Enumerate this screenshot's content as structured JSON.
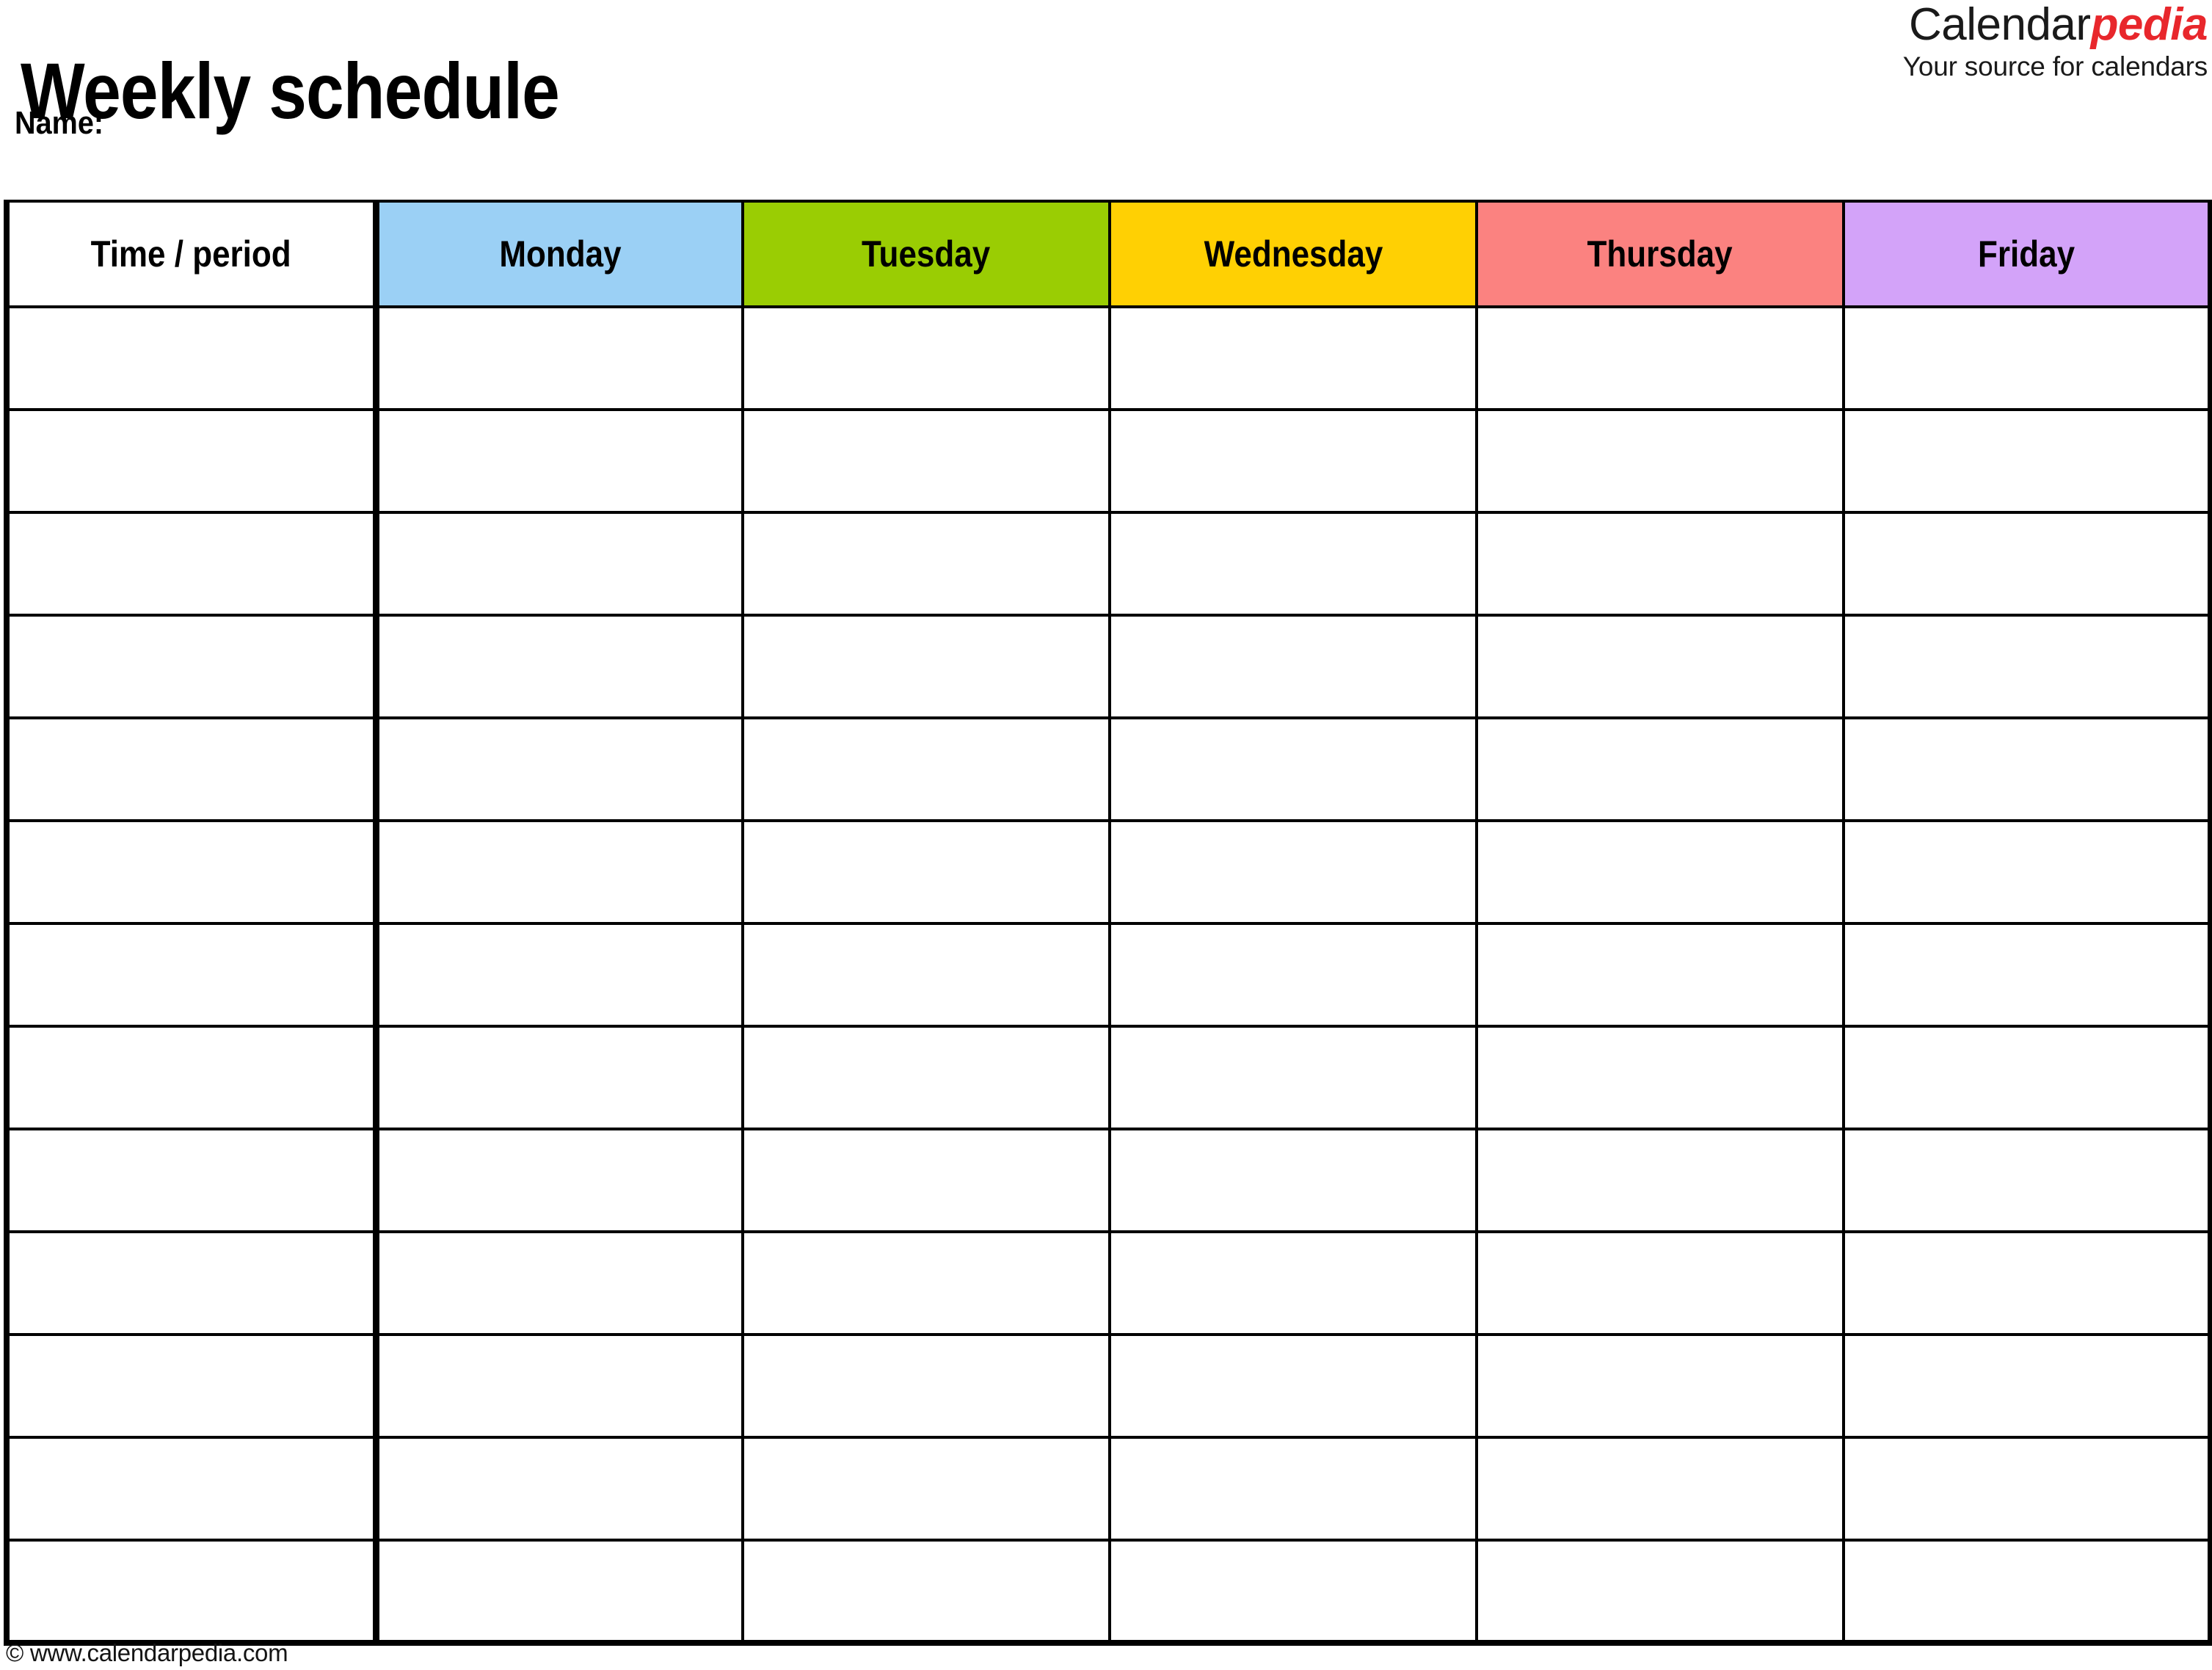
{
  "document": {
    "title": "Weekly schedule",
    "name_label": "Name:"
  },
  "brand": {
    "word_primary": "Calendar",
    "word_accent": "pedia",
    "tagline": "Your source for calendars",
    "accent_color": "#e8272c",
    "primary_color": "#1a1a1a"
  },
  "table": {
    "columns": [
      {
        "key": "time",
        "label": "Time / period",
        "bg": "#ffffff"
      },
      {
        "key": "monday",
        "label": "Monday",
        "bg": "#9bd0f5"
      },
      {
        "key": "tuesday",
        "label": "Tuesday",
        "bg": "#9acd03"
      },
      {
        "key": "wednesday",
        "label": "Wednesday",
        "bg": "#ffd003"
      },
      {
        "key": "thursday",
        "label": "Thursday",
        "bg": "#fb8280"
      },
      {
        "key": "friday",
        "label": "Friday",
        "bg": "#d3a3f9"
      }
    ],
    "row_count": 13,
    "rows": [
      {
        "time": "",
        "monday": "",
        "tuesday": "",
        "wednesday": "",
        "thursday": "",
        "friday": ""
      },
      {
        "time": "",
        "monday": "",
        "tuesday": "",
        "wednesday": "",
        "thursday": "",
        "friday": ""
      },
      {
        "time": "",
        "monday": "",
        "tuesday": "",
        "wednesday": "",
        "thursday": "",
        "friday": ""
      },
      {
        "time": "",
        "monday": "",
        "tuesday": "",
        "wednesday": "",
        "thursday": "",
        "friday": ""
      },
      {
        "time": "",
        "monday": "",
        "tuesday": "",
        "wednesday": "",
        "thursday": "",
        "friday": ""
      },
      {
        "time": "",
        "monday": "",
        "tuesday": "",
        "wednesday": "",
        "thursday": "",
        "friday": ""
      },
      {
        "time": "",
        "monday": "",
        "tuesday": "",
        "wednesday": "",
        "thursday": "",
        "friday": ""
      },
      {
        "time": "",
        "monday": "",
        "tuesday": "",
        "wednesday": "",
        "thursday": "",
        "friday": ""
      },
      {
        "time": "",
        "monday": "",
        "tuesday": "",
        "wednesday": "",
        "thursday": "",
        "friday": ""
      },
      {
        "time": "",
        "monday": "",
        "tuesday": "",
        "wednesday": "",
        "thursday": "",
        "friday": ""
      },
      {
        "time": "",
        "monday": "",
        "tuesday": "",
        "wednesday": "",
        "thursday": "",
        "friday": ""
      },
      {
        "time": "",
        "monday": "",
        "tuesday": "",
        "wednesday": "",
        "thursday": "",
        "friday": ""
      },
      {
        "time": "",
        "monday": "",
        "tuesday": "",
        "wednesday": "",
        "thursday": "",
        "friday": ""
      }
    ]
  },
  "footer": {
    "copyright": "© www.calendarpedia.com"
  }
}
